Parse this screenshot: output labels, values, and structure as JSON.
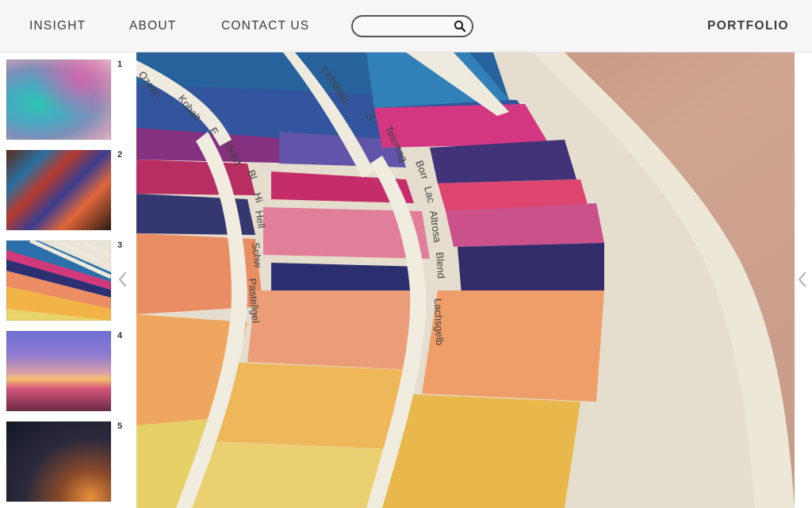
{
  "header": {
    "nav": [
      "INSIGHT",
      "ABOUT",
      "CONTACT US"
    ],
    "search": {
      "placeholder": "",
      "value": ""
    },
    "brand": "PORTFOLIO"
  },
  "sidebar": {
    "thumbnails": [
      {
        "number": "1"
      },
      {
        "number": "2"
      },
      {
        "number": "3"
      },
      {
        "number": "4"
      },
      {
        "number": "5"
      }
    ],
    "selected": "3"
  },
  "main": {
    "image": "color swatch fan",
    "swatch_labels": [
      "Ozean",
      "Kobalt",
      "E",
      "Violet",
      "Bl",
      "Hi",
      "Hell",
      "Schw",
      "Pastellgel",
      "Lichtblau",
      "S",
      "Telemag",
      "Borr",
      "Lac",
      "Altrosa",
      "Blend",
      "Lachsgelb"
    ]
  },
  "colors": {
    "header_bg": "#f6f6f6",
    "text": "#3b3b3b",
    "page_bg": "#ffffff"
  }
}
